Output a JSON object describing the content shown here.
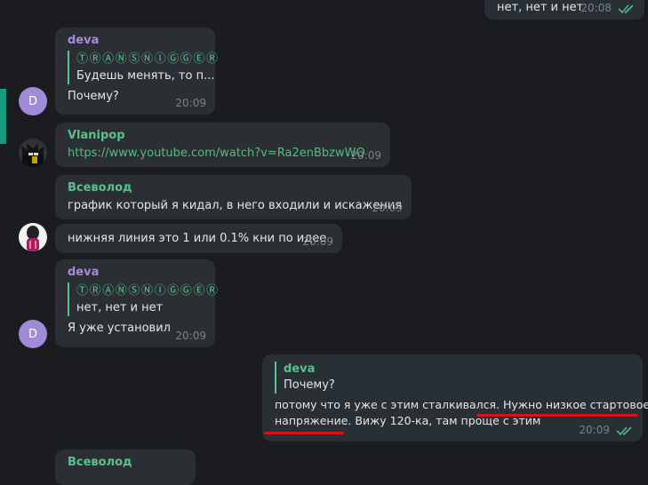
{
  "colors": {
    "background": "#1a1c1f",
    "bubble": "#2b2f33",
    "own_bubble": "#283036",
    "author_deva": "#a68ae0",
    "author_green": "#58c18e",
    "link": "#52bd7a",
    "timestamp": "#7c8186",
    "read_check": "#4fb58a",
    "underline": "#d8121b",
    "selection_bar": "#139c7e"
  },
  "messages": [
    {
      "id": "m0",
      "own": true,
      "text": "нет, нет и нет",
      "time": "20:08",
      "read": true
    },
    {
      "id": "m1",
      "author": "deva",
      "avatar_letter": "D",
      "reply": {
        "name": "ⓉⓇⒶⓃⓈⓃⒾⒼⒼⒺⓇ",
        "text": "Будешь менять, то п..."
      },
      "text": "Почему?",
      "time": "20:09"
    },
    {
      "id": "m2",
      "author": "Vlanipop",
      "avatar_icon": "dark-character-avatar-icon",
      "link": "https://www.youtube.com/watch?v=Ra2enBbzwWQ",
      "time": "20:09"
    },
    {
      "id": "m3",
      "author": "Всеволод",
      "text": "график который я кидал, в него входили и искажения",
      "time": "20:09"
    },
    {
      "id": "m4",
      "avatar_icon": "pink-character-avatar-icon",
      "text": "нижняя линия это 1 или 0.1% кни по идее",
      "time": "20:09"
    },
    {
      "id": "m5",
      "author": "deva",
      "avatar_letter": "D",
      "reply": {
        "name": "ⓉⓇⒶⓃⓈⓃⒾⒼⒼⒺⓇ",
        "text": "нет, нет и нет"
      },
      "text": "Я уже установил",
      "time": "20:09"
    },
    {
      "id": "m6",
      "own": true,
      "reply": {
        "name": "deva",
        "text": "Почему?"
      },
      "text_line1": "потому что я уже с этим сталкивался. Нужно низкое стартовое",
      "text_line2": "напряжение. Вижу 120-ка, там проще с этим",
      "time": "20:09",
      "read": true
    },
    {
      "id": "m7",
      "author": "Всеволод"
    }
  ]
}
